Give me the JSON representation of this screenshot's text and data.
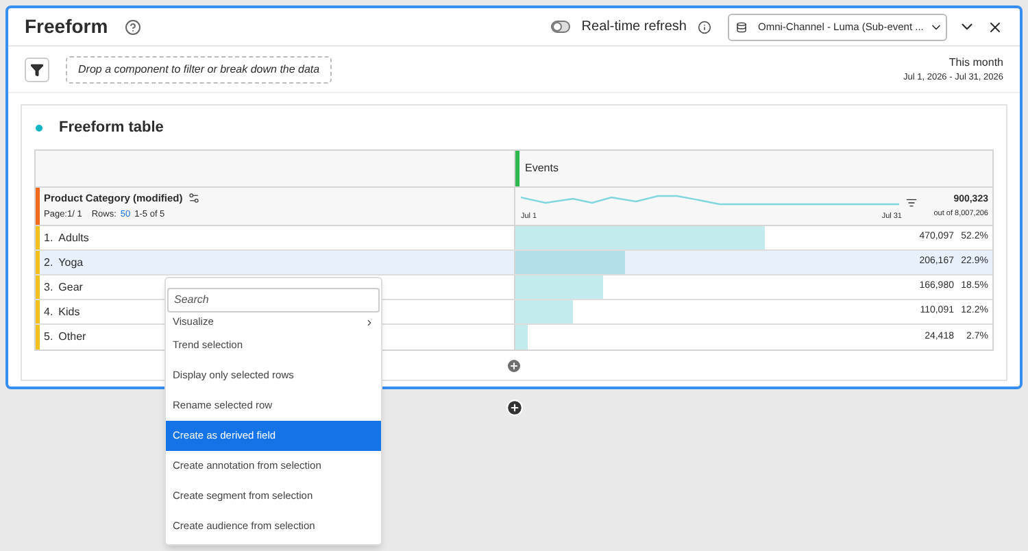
{
  "header": {
    "title": "Freeform",
    "realtime": {
      "label": "Real-time refresh",
      "on": false
    },
    "data_view": "Omni-Channel - Luma (Sub-event ..."
  },
  "filter_bar": {
    "drop_hint": "Drop a component to filter or break down the data",
    "date_label": "This month",
    "date_range": "Jul 1, 2026 - Jul 31, 2026"
  },
  "table": {
    "title": "Freeform table",
    "dimension": {
      "name": "Product Category (modified)",
      "page": "Page:1/ 1",
      "rows_label": "Rows:",
      "rows_value": "50",
      "range": "1-5 of 5"
    },
    "metric": {
      "name": "Events",
      "total": "900,323",
      "out_of": "out of 8,007,206",
      "x_start": "Jul 1",
      "x_end": "Jul 31"
    },
    "rows": [
      {
        "index": "1.",
        "label": "Adults",
        "value": "470,097",
        "percent": "52.2%",
        "selected": false
      },
      {
        "index": "2.",
        "label": "Yoga",
        "value": "206,167",
        "percent": "22.9%",
        "selected": true
      },
      {
        "index": "3.",
        "label": "Gear",
        "value": "166,980",
        "percent": "18.5%",
        "selected": false
      },
      {
        "index": "4.",
        "label": "Kids",
        "value": "110,091",
        "percent": "12.2%",
        "selected": false
      },
      {
        "index": "5.",
        "label": "Other",
        "value": "24,418",
        "percent": "2.7%",
        "selected": false
      }
    ]
  },
  "context_menu": {
    "search_placeholder": "Search",
    "items": [
      {
        "label": "Visualize",
        "submenu": true,
        "selected": false
      },
      {
        "label": "Trend selection",
        "submenu": false,
        "selected": false
      },
      {
        "label": "Display only selected rows",
        "submenu": false,
        "selected": false
      },
      {
        "label": "Rename selected row",
        "submenu": false,
        "selected": false
      },
      {
        "label": "Create as derived field",
        "submenu": false,
        "selected": true
      },
      {
        "label": "Create annotation from selection",
        "submenu": false,
        "selected": false
      },
      {
        "label": "Create segment from selection",
        "submenu": false,
        "selected": false
      },
      {
        "label": "Create audience from selection",
        "submenu": false,
        "selected": false
      }
    ]
  }
}
